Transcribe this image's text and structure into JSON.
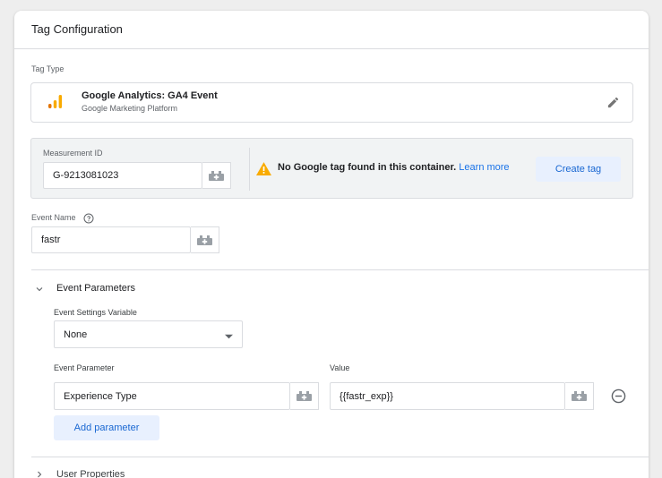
{
  "card": {
    "title": "Tag Configuration"
  },
  "tag_type": {
    "label": "Tag Type",
    "name": "Google Analytics: GA4 Event",
    "platform": "Google Marketing Platform",
    "icon": "ga4-analytics-icon",
    "edit_icon": "pencil-icon"
  },
  "measurement": {
    "label": "Measurement ID",
    "value": "G-9213081023",
    "warning_text": "No Google tag found in this container.",
    "warning_link": "Learn more",
    "create_button": "Create tag"
  },
  "event_name": {
    "label": "Event Name",
    "value": "fastr"
  },
  "event_parameters": {
    "title": "Event Parameters",
    "settings_variable_label": "Event Settings Variable",
    "settings_variable_value": "None",
    "parameter_header": "Event Parameter",
    "value_header": "Value",
    "rows": [
      {
        "parameter": "Experience Type",
        "value": "{{fastr_exp}}"
      }
    ],
    "add_button": "Add parameter"
  },
  "user_properties": {
    "title": "User Properties"
  },
  "colors": {
    "accent": "#1a73e8",
    "warning": "#f9ab00",
    "ga_orange": "#f9ab00",
    "ga_dark": "#e37400"
  }
}
